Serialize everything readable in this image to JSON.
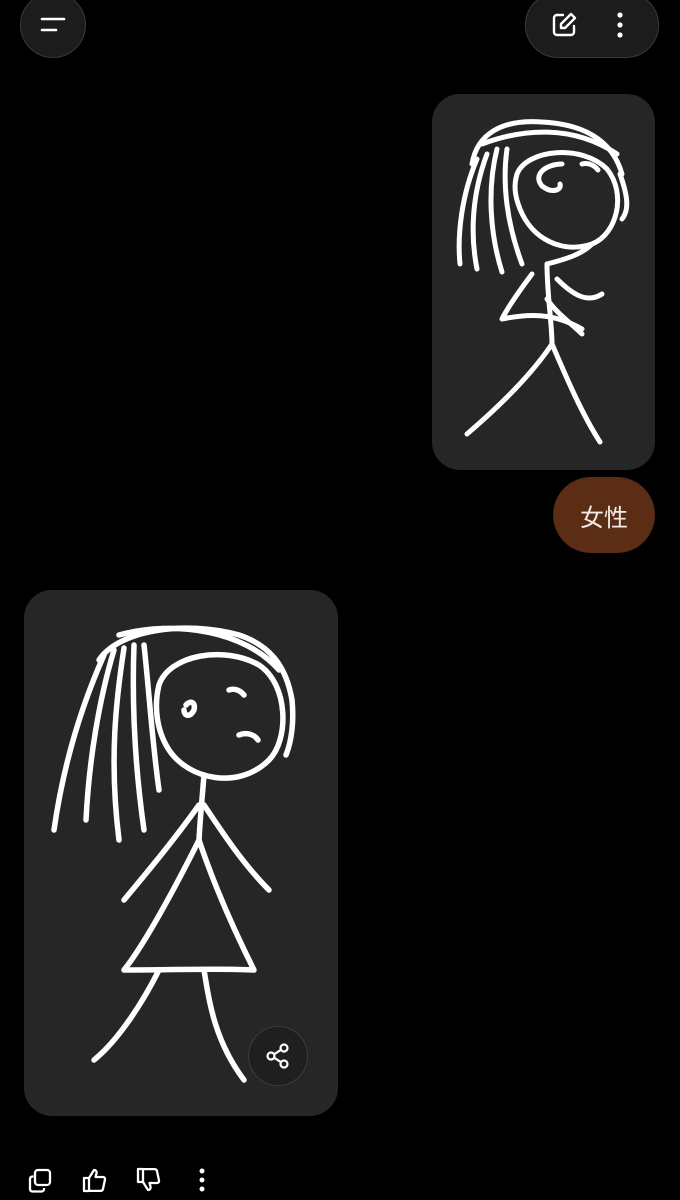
{
  "header": {
    "menu_icon": "menu-icon",
    "new_chat_icon": "edit-icon",
    "more_icon": "more-vertical-icon"
  },
  "conversation": {
    "user_message": {
      "image_description_icon": "stick-figure-sketch",
      "text": "女性"
    },
    "ai_response": {
      "image_description_icon": "stick-figure-girl-sketch",
      "share_icon": "share-icon"
    }
  },
  "response_actions": {
    "copy_icon": "copy-icon",
    "like_icon": "thumbs-up-icon",
    "dislike_icon": "thumbs-down-icon",
    "more_icon": "more-vertical-icon"
  },
  "colors": {
    "background": "#000000",
    "card": "#262626",
    "user_bubble": "#5a2d14",
    "stroke": "#ffffff"
  }
}
